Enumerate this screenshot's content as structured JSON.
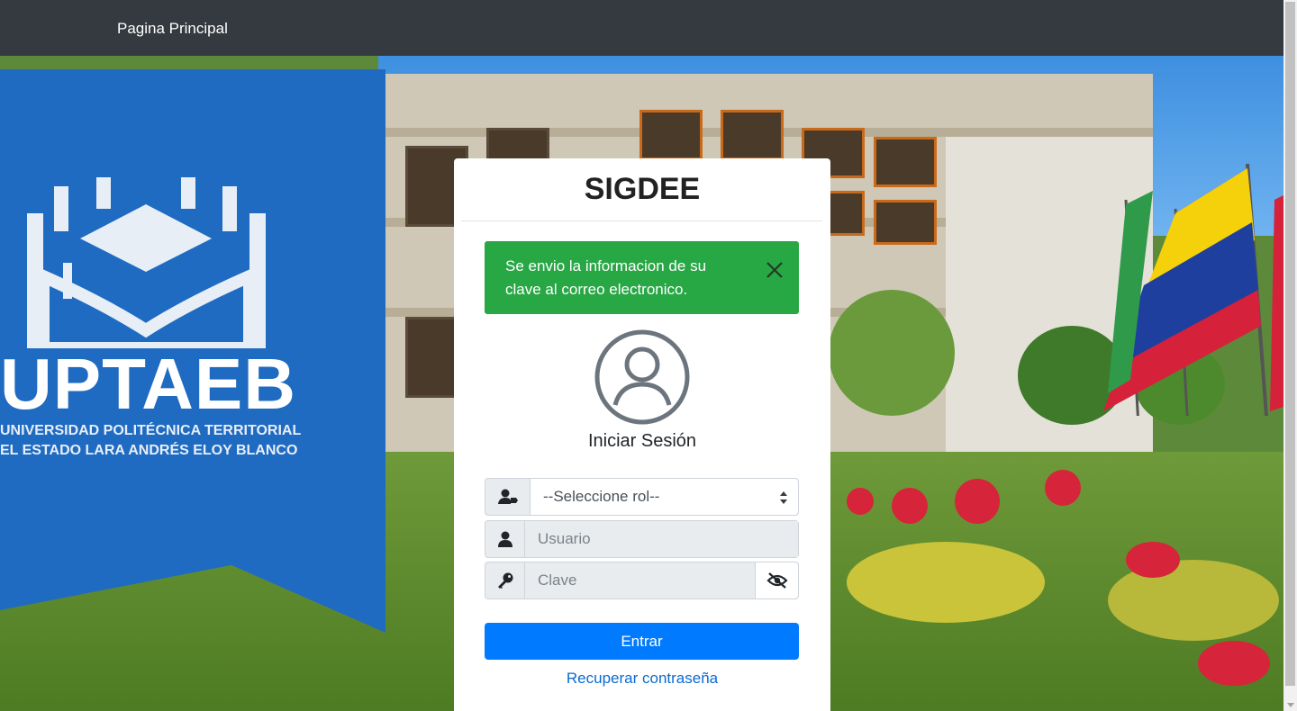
{
  "navbar": {
    "brand": "Pagina Principal"
  },
  "banner": {
    "name": "UPTAEB",
    "subtitle_line1": "UNIVERSIDAD POLITÉCNICA TERRITORIAL",
    "subtitle_line2": "EL ESTADO LARA ANDRÉS ELOY BLANCO"
  },
  "login": {
    "app_title": "SIGDEE",
    "alert": {
      "message": "Se envio la informacion de su clave al correo electronico.",
      "color": "#28a745"
    },
    "heading": "Iniciar Sesión",
    "role_select": {
      "value": "--Seleccione rol--",
      "icon": "user-tag-icon"
    },
    "username": {
      "placeholder": "Usuario",
      "icon": "user-icon"
    },
    "password": {
      "placeholder": "Clave",
      "icon": "key-icon",
      "toggle_icon": "eye-slash-icon"
    },
    "submit_label": "Entrar",
    "recover_label": "Recuperar contraseña",
    "accent_color": "#007bff"
  }
}
